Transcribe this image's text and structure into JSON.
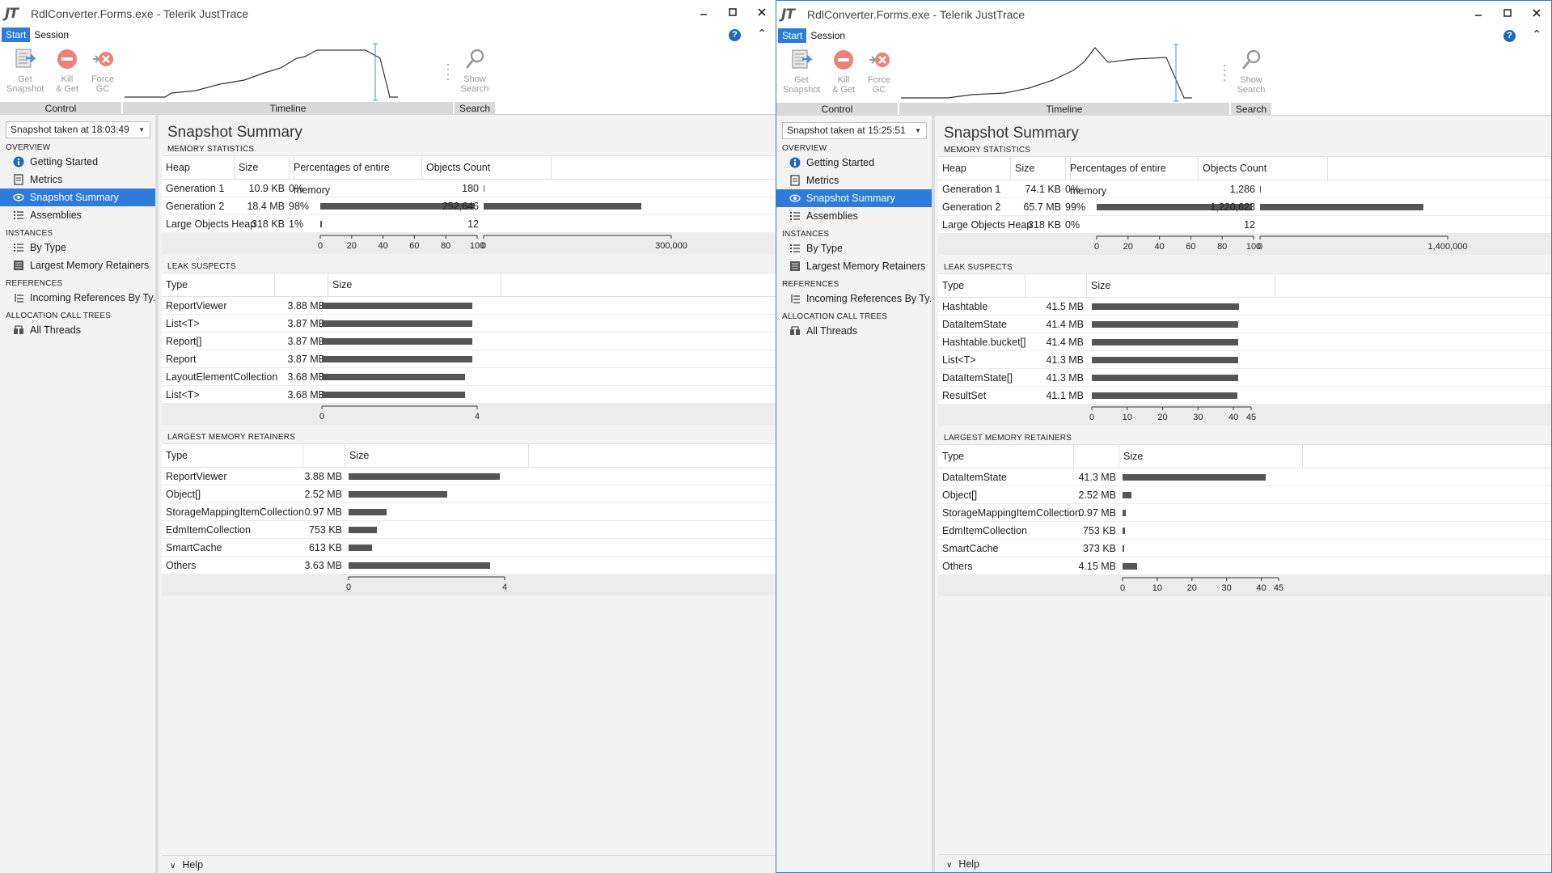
{
  "windows": [
    {
      "title": "RdlConverter.Forms.exe - Telerik JustTrace",
      "logo": "JT",
      "tabs": [
        "Start",
        "Session"
      ],
      "ribbon": {
        "buttons": [
          {
            "label1": "Get",
            "label2": "Snapshot",
            "icon": "get-snapshot-icon"
          },
          {
            "label1": "Kill",
            "label2": "& Get",
            "icon": "kill-get-icon"
          },
          {
            "label1": "Force",
            "label2": "GC",
            "icon": "force-gc-icon"
          },
          {
            "label1": "Show",
            "label2": "Search",
            "icon": "search-icon"
          }
        ],
        "groups": [
          "Control",
          "Timeline",
          "Search"
        ]
      },
      "snapshot_select": "Snapshot taken at 18:03:49",
      "sidebar": {
        "sections": [
          {
            "title": "OVERVIEW",
            "items": [
              {
                "label": "Getting Started",
                "icon": "info-icon"
              },
              {
                "label": "Metrics",
                "icon": "metrics-icon"
              },
              {
                "label": "Snapshot Summary",
                "icon": "eye-icon",
                "selected": true
              },
              {
                "label": "Assemblies",
                "icon": "list-icon"
              }
            ]
          },
          {
            "title": "INSTANCES",
            "items": [
              {
                "label": "By Type",
                "icon": "list-icon"
              },
              {
                "label": "Largest Memory Retainers",
                "icon": "retainers-icon"
              }
            ]
          },
          {
            "title": "REFERENCES",
            "items": [
              {
                "label": "Incoming References By Ty...",
                "icon": "tree-icon"
              }
            ]
          },
          {
            "title": "ALLOCATION CALL TREES",
            "items": [
              {
                "label": "All Threads",
                "icon": "threads-icon"
              }
            ]
          }
        ]
      },
      "main": {
        "title": "Snapshot Summary",
        "memory": {
          "section": "MEMORY STATISTICS",
          "headers": [
            "Heap",
            "Size",
            "",
            "Percentages of entire memory",
            "",
            "Objects Count"
          ],
          "rows": [
            {
              "heap": "Generation 1",
              "size": "10.9 KB",
              "pct": "0%",
              "pct_value": 0,
              "count": "180",
              "count_value": 180
            },
            {
              "heap": "Generation 2",
              "size": "18.4 MB",
              "pct": "98%",
              "pct_value": 98,
              "count": "252,646",
              "count_value": 252646
            },
            {
              "heap": "Large Objects Heap",
              "size": "318 KB",
              "pct": "1%",
              "pct_value": 1,
              "count": "12",
              "count_value": 12
            }
          ],
          "pct_ticks": [
            "0",
            "20",
            "40",
            "60",
            "80",
            "100"
          ],
          "count_ticks": [
            "0",
            "300,000"
          ],
          "count_max": 300000
        },
        "leak": {
          "section": "LEAK SUSPECTS",
          "headers": [
            "Type",
            "Size"
          ],
          "rows": [
            {
              "type": "ReportViewer",
              "size": "3.88 MB",
              "value": 3.88
            },
            {
              "type": "List<T>",
              "size": "3.87 MB",
              "value": 3.87
            },
            {
              "type": "Report[]",
              "size": "3.87 MB",
              "value": 3.87
            },
            {
              "type": "Report",
              "size": "3.87 MB",
              "value": 3.87
            },
            {
              "type": "LayoutElementCollection",
              "size": "3.68 MB",
              "value": 3.68
            },
            {
              "type": "List<T>",
              "size": "3.68 MB",
              "value": 3.68
            }
          ],
          "ticks": [
            "0",
            "4"
          ],
          "tick_values": [
            0,
            4
          ],
          "max": 4
        },
        "retainers": {
          "section": "LARGEST MEMORY RETAINERS",
          "headers": [
            "Type",
            "Size"
          ],
          "rows": [
            {
              "type": "ReportViewer",
              "size": "3.88 MB",
              "value": 3.88
            },
            {
              "type": "Object[]",
              "size": "2.52 MB",
              "value": 2.52
            },
            {
              "type": "StorageMappingItemCollection",
              "size": "0.97 MB",
              "value": 0.97
            },
            {
              "type": "EdmItemCollection",
              "size": "753 KB",
              "value": 0.735
            },
            {
              "type": "SmartCache",
              "size": "613 KB",
              "value": 0.6
            },
            {
              "type": "Others",
              "size": "3.63 MB",
              "value": 3.63
            }
          ],
          "ticks": [
            "0",
            "4"
          ],
          "tick_values": [
            0,
            4
          ],
          "max": 4
        },
        "footer": "Help"
      }
    },
    {
      "title": "RdlConverter.Forms.exe - Telerik JustTrace",
      "logo": "JT",
      "tabs": [
        "Start",
        "Session"
      ],
      "ribbon": {
        "buttons": [
          {
            "label1": "Get",
            "label2": "Snapshot",
            "icon": "get-snapshot-icon"
          },
          {
            "label1": "Kill",
            "label2": "& Get",
            "icon": "kill-get-icon"
          },
          {
            "label1": "Force",
            "label2": "GC",
            "icon": "force-gc-icon"
          },
          {
            "label1": "Show",
            "label2": "Search",
            "icon": "search-icon"
          }
        ],
        "groups": [
          "Control",
          "Timeline",
          "Search"
        ]
      },
      "snapshot_select": "Snapshot taken at 15:25:51",
      "sidebar": {
        "sections": [
          {
            "title": "OVERVIEW",
            "items": [
              {
                "label": "Getting Started",
                "icon": "info-icon"
              },
              {
                "label": "Metrics",
                "icon": "metrics-icon"
              },
              {
                "label": "Snapshot Summary",
                "icon": "eye-icon",
                "selected": true
              },
              {
                "label": "Assemblies",
                "icon": "list-icon"
              }
            ]
          },
          {
            "title": "INSTANCES",
            "items": [
              {
                "label": "By Type",
                "icon": "list-icon"
              },
              {
                "label": "Largest Memory Retainers",
                "icon": "retainers-icon"
              }
            ]
          },
          {
            "title": "REFERENCES",
            "items": [
              {
                "label": "Incoming References By Ty...",
                "icon": "tree-icon"
              }
            ]
          },
          {
            "title": "ALLOCATION CALL TREES",
            "items": [
              {
                "label": "All Threads",
                "icon": "threads-icon"
              }
            ]
          }
        ]
      },
      "main": {
        "title": "Snapshot Summary",
        "memory": {
          "section": "MEMORY STATISTICS",
          "headers": [
            "Heap",
            "Size",
            "",
            "Percentages of entire memory",
            "",
            "Objects Count"
          ],
          "rows": [
            {
              "heap": "Generation 1",
              "size": "74.1 KB",
              "pct": "0%",
              "pct_value": 0,
              "count": "1,286",
              "count_value": 1286
            },
            {
              "heap": "Generation 2",
              "size": "65.7 MB",
              "pct": "99%",
              "pct_value": 99,
              "count": "1,220,623",
              "count_value": 1220623
            },
            {
              "heap": "Large Objects Heap",
              "size": "318 KB",
              "pct": "0%",
              "pct_value": 0,
              "count": "12",
              "count_value": 12
            }
          ],
          "pct_ticks": [
            "0",
            "20",
            "40",
            "60",
            "80",
            "100"
          ],
          "count_ticks": [
            "0",
            "1,400,000"
          ],
          "count_max": 1400000
        },
        "leak": {
          "section": "LEAK SUSPECTS",
          "headers": [
            "Type",
            "Size"
          ],
          "rows": [
            {
              "type": "Hashtable",
              "size": "41.5 MB",
              "value": 41.5
            },
            {
              "type": "DataItemState",
              "size": "41.4 MB",
              "value": 41.4
            },
            {
              "type": "Hashtable.bucket[]",
              "size": "41.4 MB",
              "value": 41.4
            },
            {
              "type": "List<T>",
              "size": "41.3 MB",
              "value": 41.3
            },
            {
              "type": "DataItemState[]",
              "size": "41.3 MB",
              "value": 41.3
            },
            {
              "type": "ResultSet",
              "size": "41.1 MB",
              "value": 41.1
            }
          ],
          "ticks": [
            "0",
            "10",
            "20",
            "30",
            "40",
            "45"
          ],
          "tick_values": [
            0,
            10,
            20,
            30,
            40,
            45
          ],
          "max": 45
        },
        "retainers": {
          "section": "LARGEST MEMORY RETAINERS",
          "headers": [
            "Type",
            "Size"
          ],
          "rows": [
            {
              "type": "DataItemState",
              "size": "41.3 MB",
              "value": 41.3
            },
            {
              "type": "Object[]",
              "size": "2.52 MB",
              "value": 2.52
            },
            {
              "type": "StorageMappingItemCollection",
              "size": "0.97 MB",
              "value": 0.97
            },
            {
              "type": "EdmItemCollection",
              "size": "753 KB",
              "value": 0.735
            },
            {
              "type": "SmartCache",
              "size": "373 KB",
              "value": 0.364
            },
            {
              "type": "Others",
              "size": "4.15 MB",
              "value": 4.15
            }
          ],
          "ticks": [
            "0",
            "10",
            "20",
            "30",
            "40",
            "45"
          ],
          "tick_values": [
            0,
            10,
            20,
            30,
            40,
            45
          ],
          "max": 45
        },
        "footer": "Help"
      }
    }
  ],
  "colors": {
    "accent": "#2f7bd9",
    "bar": "#555555",
    "help": "#1e68c0"
  }
}
